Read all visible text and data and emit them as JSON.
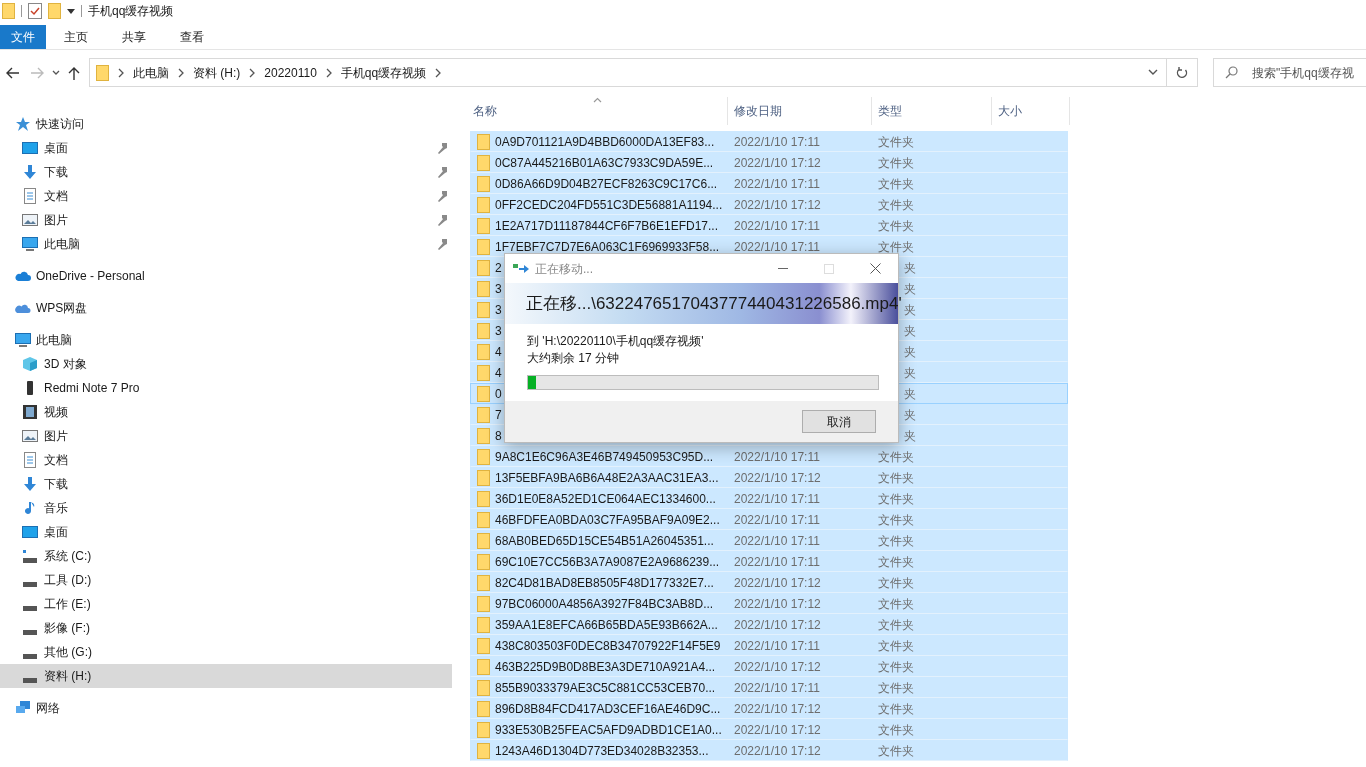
{
  "window": {
    "title": "手机qq缓存视频"
  },
  "ribbon_tabs": [
    {
      "label": "文件",
      "selected": true
    },
    {
      "label": "主页",
      "selected": false
    },
    {
      "label": "共享",
      "selected": false
    },
    {
      "label": "查看",
      "selected": false
    }
  ],
  "address_bar": {
    "crumbs": [
      "此电脑",
      "资料 (H:)",
      "20220110",
      "手机qq缓存视频"
    ],
    "forward_disabled": true
  },
  "search": {
    "placeholder": "搜索\"手机qq缓存视"
  },
  "sidebar": [
    {
      "label": "快速访问",
      "kind": "star",
      "selected": false,
      "children": [
        {
          "label": "桌面",
          "kind": "desktop",
          "pinned": true,
          "selected": false
        },
        {
          "label": "下载",
          "kind": "download",
          "pinned": true,
          "selected": false
        },
        {
          "label": "文档",
          "kind": "document",
          "pinned": true,
          "selected": false
        },
        {
          "label": "图片",
          "kind": "pictures",
          "pinned": true,
          "selected": false
        },
        {
          "label": "此电脑",
          "kind": "computer",
          "pinned": true,
          "selected": false
        }
      ]
    },
    {
      "label": "OneDrive - Personal",
      "kind": "cloud",
      "selected": false
    },
    {
      "label": "WPS网盘",
      "kind": "cloud2",
      "selected": false
    },
    {
      "label": "此电脑",
      "kind": "computer",
      "selected": false,
      "children": [
        {
          "label": "3D 对象",
          "kind": "cube",
          "selected": false
        },
        {
          "label": "Redmi Note 7 Pro",
          "kind": "phone",
          "selected": false
        },
        {
          "label": "视频",
          "kind": "video",
          "selected": false
        },
        {
          "label": "图片",
          "kind": "pictures",
          "selected": false
        },
        {
          "label": "文档",
          "kind": "document",
          "selected": false
        },
        {
          "label": "下载",
          "kind": "download",
          "selected": false
        },
        {
          "label": "音乐",
          "kind": "music",
          "selected": false
        },
        {
          "label": "桌面",
          "kind": "desktop",
          "selected": false
        },
        {
          "label": "系统 (C:)",
          "kind": "system-drive",
          "selected": false
        },
        {
          "label": "工具 (D:)",
          "kind": "drive",
          "selected": false
        },
        {
          "label": "工作 (E:)",
          "kind": "drive",
          "selected": false
        },
        {
          "label": "影像 (F:)",
          "kind": "drive",
          "selected": false
        },
        {
          "label": "其他 (G:)",
          "kind": "drive",
          "selected": false
        },
        {
          "label": "资料 (H:)",
          "kind": "drive",
          "selected": true
        }
      ]
    },
    {
      "label": "网络",
      "kind": "network",
      "selected": false
    }
  ],
  "table": {
    "columns": [
      "名称",
      "修改日期",
      "类型",
      "大小"
    ],
    "rows": [
      {
        "kind": "file",
        "name": "0A9D701121A9D4BBD6000DA13EF83...",
        "date": "2022/1/10 17:11",
        "type": "文件夹",
        "selected": true,
        "focused": false
      },
      {
        "kind": "file",
        "name": "0C87A445216B01A63C7933C9DA59E...",
        "date": "2022/1/10 17:12",
        "type": "文件夹",
        "selected": true,
        "focused": false
      },
      {
        "kind": "file",
        "name": "0D86A66D9D04B27ECF8263C9C17C6...",
        "date": "2022/1/10 17:11",
        "type": "文件夹",
        "selected": true,
        "focused": false
      },
      {
        "kind": "file",
        "name": "0FF2CEDC204FD551C3DE56881A1194...",
        "date": "2022/1/10 17:12",
        "type": "文件夹",
        "selected": true,
        "focused": false
      },
      {
        "kind": "file",
        "name": "1E2A717D11187844CF6F7B6E1EFD17...",
        "date": "2022/1/10 17:11",
        "type": "文件夹",
        "selected": true,
        "focused": false
      },
      {
        "kind": "file",
        "name": "1F7EBF7C7D7E6A063C1F6969933F58...",
        "date": "2022/1/10 17:11",
        "type": "文件夹",
        "selected": true,
        "focused": false
      },
      {
        "kind": "covered",
        "name": "2",
        "type": "夹",
        "selected": true,
        "focused": false
      },
      {
        "kind": "covered",
        "name": "3",
        "type": "夹",
        "selected": true,
        "focused": false
      },
      {
        "kind": "covered",
        "name": "3",
        "type": "夹",
        "selected": true,
        "focused": false
      },
      {
        "kind": "covered",
        "name": "3",
        "type": "夹",
        "selected": true,
        "focused": false
      },
      {
        "kind": "covered",
        "name": "4",
        "type": "夹",
        "selected": true,
        "focused": false
      },
      {
        "kind": "covered",
        "name": "4",
        "type": "夹",
        "selected": true,
        "focused": false
      },
      {
        "kind": "covered",
        "name": "0",
        "type": "夹",
        "selected": true,
        "focused": true
      },
      {
        "kind": "covered",
        "name": "7",
        "type": "夹",
        "selected": true,
        "focused": false
      },
      {
        "kind": "covered",
        "name": "8",
        "type": "夹",
        "selected": true,
        "focused": false
      },
      {
        "kind": "file",
        "name": "9A8C1E6C96A3E46B749450953C95D...",
        "date": "2022/1/10 17:11",
        "type": "文件夹",
        "selected": true,
        "focused": false
      },
      {
        "kind": "file",
        "name": "13F5EBFA9BA6B6A48E2A3AAC31EA3...",
        "date": "2022/1/10 17:12",
        "type": "文件夹",
        "selected": true,
        "focused": false
      },
      {
        "kind": "file",
        "name": "36D1E0E8A52ED1CE064AEC1334600...",
        "date": "2022/1/10 17:11",
        "type": "文件夹",
        "selected": true,
        "focused": false
      },
      {
        "kind": "file",
        "name": "46BFDFEA0BDA03C7FA95BAF9A09E2...",
        "date": "2022/1/10 17:11",
        "type": "文件夹",
        "selected": true,
        "focused": false
      },
      {
        "kind": "file",
        "name": "68AB0BED65D15CE54B51A26045351...",
        "date": "2022/1/10 17:11",
        "type": "文件夹",
        "selected": true,
        "focused": false
      },
      {
        "kind": "file",
        "name": "69C10E7CC56B3A7A9087E2A9686239...",
        "date": "2022/1/10 17:11",
        "type": "文件夹",
        "selected": true,
        "focused": false
      },
      {
        "kind": "file",
        "name": "82C4D81BAD8EB8505F48D177332E7...",
        "date": "2022/1/10 17:12",
        "type": "文件夹",
        "selected": true,
        "focused": false
      },
      {
        "kind": "file",
        "name": "97BC06000A4856A3927F84BC3AB8D...",
        "date": "2022/1/10 17:12",
        "type": "文件夹",
        "selected": true,
        "focused": false
      },
      {
        "kind": "file",
        "name": "359AA1E8EFCA66B65BDA5E93B662A...",
        "date": "2022/1/10 17:12",
        "type": "文件夹",
        "selected": true,
        "focused": false
      },
      {
        "kind": "file",
        "name": "438C803503F0DEC8B34707922F14F5E9",
        "date": "2022/1/10 17:11",
        "type": "文件夹",
        "selected": true,
        "focused": false
      },
      {
        "kind": "file",
        "name": "463B225D9B0D8BE3A3DE710A921A4...",
        "date": "2022/1/10 17:12",
        "type": "文件夹",
        "selected": true,
        "focused": false
      },
      {
        "kind": "file",
        "name": "855B9033379AE3C5C881CC53CEB70...",
        "date": "2022/1/10 17:11",
        "type": "文件夹",
        "selected": true,
        "focused": false
      },
      {
        "kind": "file",
        "name": "896D8B84FCD417AD3CEF16AE46D9C...",
        "date": "2022/1/10 17:12",
        "type": "文件夹",
        "selected": true,
        "focused": false
      },
      {
        "kind": "file",
        "name": "933E530B25FEAC5AFD9ADBD1CE1A0...",
        "date": "2022/1/10 17:12",
        "type": "文件夹",
        "selected": true,
        "focused": false
      },
      {
        "kind": "file",
        "name": "1243A46D1304D773ED34028B32353...",
        "date": "2022/1/10 17:12",
        "type": "文件夹",
        "selected": true,
        "focused": false
      }
    ]
  },
  "dialog": {
    "title": "正在移动...",
    "maximize_disabled": true,
    "heading": "正在移...\\6322476517043777440431226586.mp4'",
    "destination": "到 'H:\\20220110\\手机qq缓存视频'",
    "time_left": "大约剩余 17 分钟",
    "progress": {
      "level": 0.023
    },
    "buttons": [
      "取消"
    ]
  }
}
